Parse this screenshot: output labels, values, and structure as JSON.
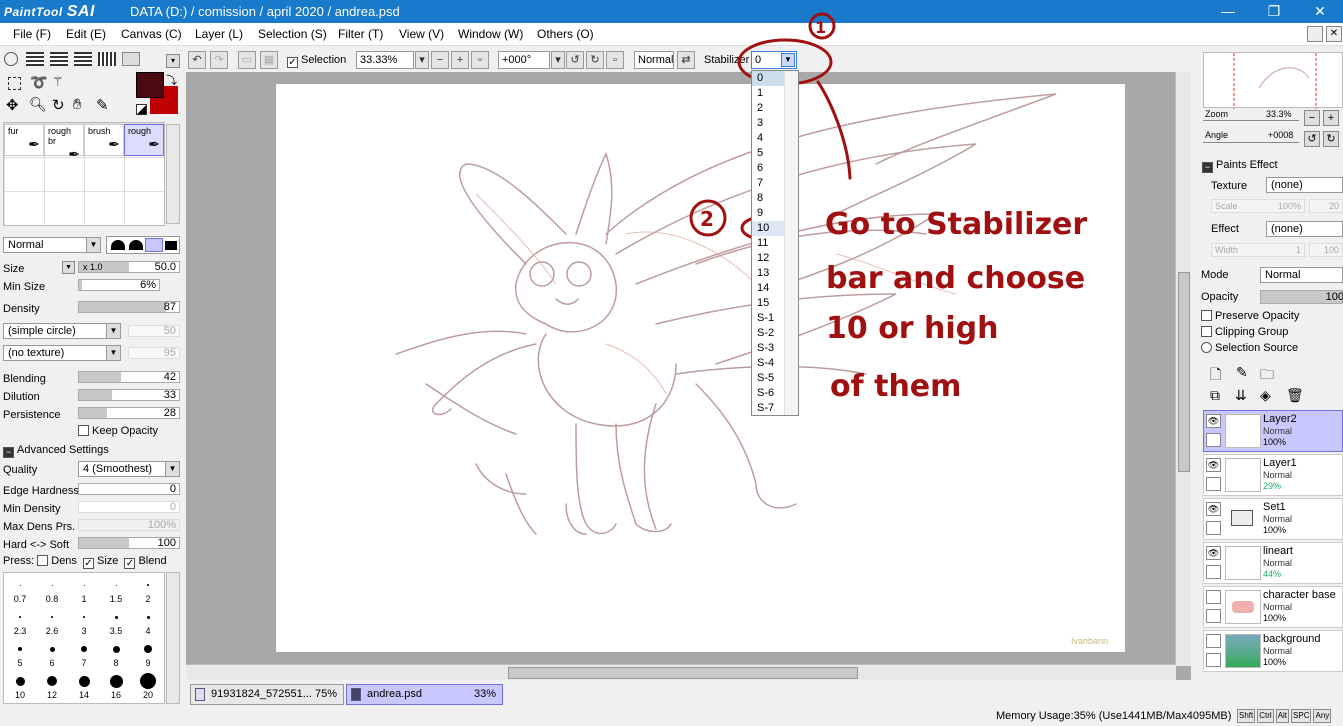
{
  "app": {
    "logo_text": "PaintTool",
    "logo_bold": "SAI",
    "title": "DATA (D:) / comission / april 2020 / andrea.psd"
  },
  "window_controls": {
    "minimize": "—",
    "maximize": "❐",
    "close": "✕"
  },
  "menu": [
    {
      "label": "File (F)"
    },
    {
      "label": "Edit (E)"
    },
    {
      "label": "Canvas (C)"
    },
    {
      "label": "Layer (L)"
    },
    {
      "label": "Selection (S)"
    },
    {
      "label": "Filter (T)"
    },
    {
      "label": "View (V)"
    },
    {
      "label": "Window (W)"
    },
    {
      "label": "Others (O)"
    }
  ],
  "toolbar": {
    "selection_label": "Selection",
    "zoom": "33.33%",
    "angle": "+000°",
    "blend_mode": "Normal",
    "stabilizer_label": "Stabilizer",
    "stabilizer_value": "0"
  },
  "stabilizer_options": [
    "0",
    "1",
    "2",
    "3",
    "4",
    "5",
    "6",
    "7",
    "8",
    "9",
    "10",
    "11",
    "12",
    "13",
    "14",
    "15",
    "S-1",
    "S-2",
    "S-3",
    "S-4",
    "S-5",
    "S-6",
    "S-7"
  ],
  "stabilizer_highlighted": "10",
  "annotations": {
    "mark1": "1",
    "mark2": "2",
    "line1": "Go to Stabilizer",
    "line2": "bar and choose",
    "line3": "10 or high",
    "line4": "of them",
    "signature": "Ivanbann"
  },
  "brushes": [
    {
      "label": "fur"
    },
    {
      "label": "rough br"
    },
    {
      "label": "brush"
    },
    {
      "label": "rough"
    }
  ],
  "brush_settings": {
    "mode": "Normal",
    "size_label": "Size",
    "size_multiplier": "x 1.0",
    "size_value": "50.0",
    "min_size_label": "Min Size",
    "min_size_value": "6%",
    "density_label": "Density",
    "density_value": "87",
    "shape": "(simple circle)",
    "shape_value": "50",
    "texture": "(no texture)",
    "texture_value": "95",
    "blending_label": "Blending",
    "blending_value": "42",
    "dilution_label": "Dilution",
    "dilution_value": "33",
    "persistence_label": "Persistence",
    "persistence_value": "28",
    "keep_opacity_label": "Keep Opacity",
    "advanced_label": "Advanced Settings",
    "quality_label": "Quality",
    "quality_value": "4 (Smoothest)",
    "edge_hardness_label": "Edge Hardness",
    "edge_hardness_value": "0",
    "min_density_label": "Min Density",
    "min_density_value": "0",
    "max_dens_label": "Max Dens Prs.",
    "max_dens_value": "100%",
    "hard_soft_label": "Hard <-> Soft",
    "hard_soft_value": "100",
    "press_label": "Press:",
    "press_dens": "Dens",
    "press_size": "Size",
    "press_blend": "Blend"
  },
  "brush_sizes": [
    "0.7",
    "0.8",
    "1",
    "1.5",
    "2",
    "2.3",
    "2.6",
    "3",
    "3.5",
    "4",
    "5",
    "6",
    "7",
    "8",
    "9",
    "10",
    "12",
    "14",
    "16",
    "20"
  ],
  "colors": {
    "primary": "#4a0a10",
    "secondary": "#c00000"
  },
  "navigator": {
    "zoom_label": "Zoom",
    "zoom_value": "33.3%",
    "angle_label": "Angle",
    "angle_value": "+0008"
  },
  "paints_effect": {
    "header": "Paints Effect",
    "texture_label": "Texture",
    "texture_value": "(none)",
    "scale_label": "Scale",
    "scale_value": "100%",
    "scale_num": "20",
    "effect_label": "Effect",
    "effect_value": "(none)",
    "width_label": "Width",
    "width_value": "1",
    "width_num": "100"
  },
  "layer_props": {
    "mode_label": "Mode",
    "mode_value": "Normal",
    "opacity_label": "Opacity",
    "opacity_value": "100",
    "preserve_opacity": "Preserve Opacity",
    "clipping_group": "Clipping Group",
    "selection_source": "Selection Source"
  },
  "layers": [
    {
      "name": "Layer2",
      "mode": "Normal",
      "opacity": "100%",
      "active": true
    },
    {
      "name": "Layer1",
      "mode": "Normal",
      "opacity": "29%",
      "active": false
    },
    {
      "name": "Set1",
      "mode": "Normal",
      "opacity": "100%",
      "active": false
    },
    {
      "name": "lineart",
      "mode": "Normal",
      "opacity": "44%",
      "active": false
    },
    {
      "name": "character base",
      "mode": "Normal",
      "opacity": "100%",
      "active": false
    },
    {
      "name": "background",
      "mode": "Normal",
      "opacity": "100%",
      "active": false
    }
  ],
  "documents": [
    {
      "name": "91931824_572551...",
      "zoom": "75%",
      "active": false
    },
    {
      "name": "andrea.psd",
      "zoom": "33%",
      "active": true
    }
  ],
  "status": {
    "memory": "Memory Usage:35% (Use1441MB/Max4095MB)",
    "keys": [
      "Shft",
      "Ctrl",
      "Alt",
      "SPC",
      "Any"
    ]
  }
}
